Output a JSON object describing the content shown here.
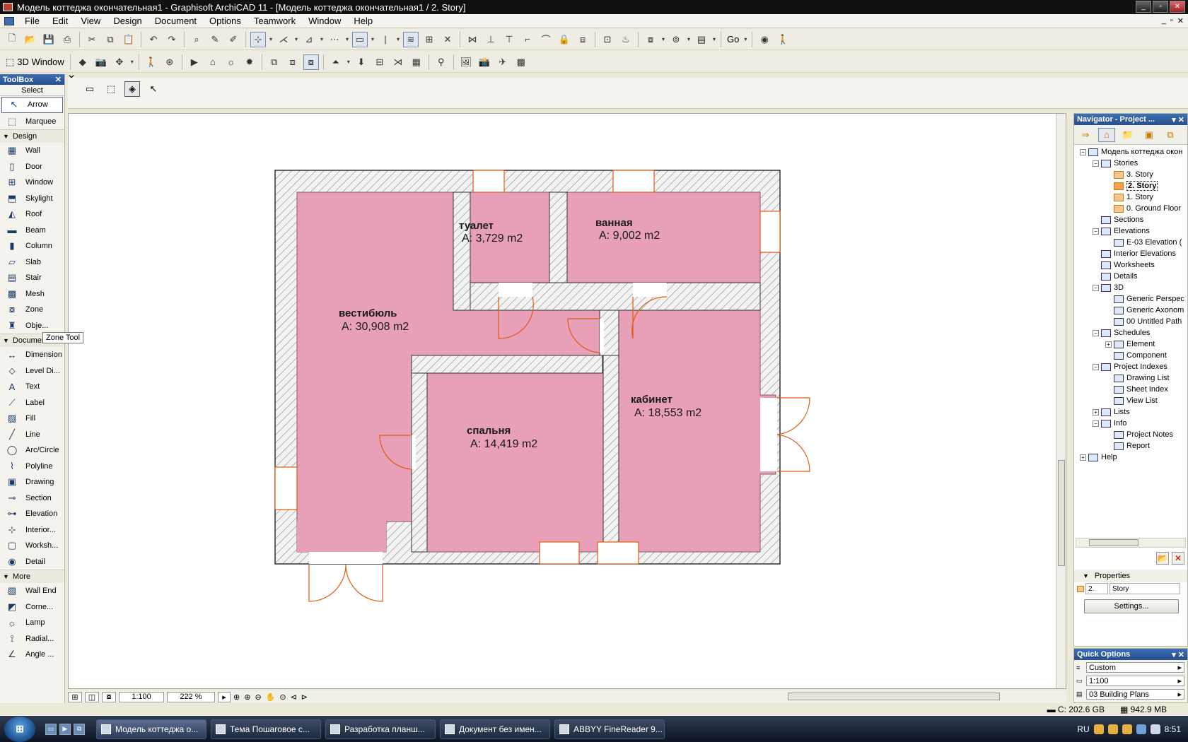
{
  "window": {
    "title": "Модель коттеджа окончательная1 - Graphisoft ArchiCAD 11 - [Модель коттеджа окончательная1 / 2. Story]"
  },
  "menu": [
    "File",
    "Edit",
    "View",
    "Design",
    "Document",
    "Options",
    "Teamwork",
    "Window",
    "Help"
  ],
  "toolbar2": {
    "window3d_label": "3D Window",
    "go_label": "Go"
  },
  "toolbox": {
    "title": "ToolBox",
    "select_label": "Select",
    "select_items": [
      {
        "label": "Arrow",
        "icon": "arrow-icon"
      },
      {
        "label": "Marquee",
        "icon": "marquee-icon"
      }
    ],
    "groups": [
      {
        "label": "Design",
        "items": [
          "Wall",
          "Door",
          "Window",
          "Skylight",
          "Roof",
          "Beam",
          "Column",
          "Slab",
          "Stair",
          "Mesh",
          "Zone",
          "Obje..."
        ]
      },
      {
        "label": "Document",
        "items": [
          "Dimension",
          "Level Di...",
          "Text",
          "Label",
          "Fill",
          "Line",
          "Arc/Circle",
          "Polyline",
          "Drawing",
          "Section",
          "Elevation",
          "Interior...",
          "Worksh...",
          "Detail"
        ]
      },
      {
        "label": "More",
        "items": [
          "Wall End",
          "Corne...",
          "Lamp",
          "Radial...",
          "Angle ..."
        ]
      }
    ],
    "tooltip": "Zone Tool"
  },
  "plan": {
    "rooms": [
      {
        "name": "туалет",
        "area": "A: 3,729 m2"
      },
      {
        "name": "ванная",
        "area": "A: 9,002 m2"
      },
      {
        "name": "вестибюль",
        "area": "A: 30,908 m2"
      },
      {
        "name": "кабинет",
        "area": "A: 18,553 m2"
      },
      {
        "name": "спальня",
        "area": "A: 14,419 m2"
      }
    ],
    "colors": {
      "zone": "#e7a0b8",
      "wall": "#eeeeee",
      "door": "#e05a10"
    }
  },
  "status": {
    "scale": "1:100",
    "zoom": "222 %"
  },
  "navigator": {
    "title": "Navigator - Project ...",
    "tree": [
      {
        "label": "Модель коттеджа окон",
        "level": 0,
        "tog": "-",
        "icon": "house-icon"
      },
      {
        "label": "Stories",
        "level": 1,
        "tog": "-",
        "icon": "stories-icon"
      },
      {
        "label": "3. Story",
        "level": 2,
        "tog": "",
        "icon": "story-icon"
      },
      {
        "label": "2. Story",
        "level": 2,
        "tog": "",
        "icon": "story-icon",
        "current": true
      },
      {
        "label": "1. Story",
        "level": 2,
        "tog": "",
        "icon": "story-icon"
      },
      {
        "label": "0. Ground Floor",
        "level": 2,
        "tog": "",
        "icon": "story-icon"
      },
      {
        "label": "Sections",
        "level": 1,
        "tog": "",
        "icon": "section-icon"
      },
      {
        "label": "Elevations",
        "level": 1,
        "tog": "-",
        "icon": "elevation-icon"
      },
      {
        "label": "E-03 Elevation (",
        "level": 2,
        "tog": "",
        "icon": "elevation-icon"
      },
      {
        "label": "Interior Elevations",
        "level": 1,
        "tog": "",
        "icon": "interior-icon"
      },
      {
        "label": "Worksheets",
        "level": 1,
        "tog": "",
        "icon": "worksheet-icon"
      },
      {
        "label": "Details",
        "level": 1,
        "tog": "",
        "icon": "detail-icon"
      },
      {
        "label": "3D",
        "level": 1,
        "tog": "-",
        "icon": "cube-icon"
      },
      {
        "label": "Generic Perspec",
        "level": 2,
        "tog": "",
        "icon": "camera-icon"
      },
      {
        "label": "Generic Axonom",
        "level": 2,
        "tog": "",
        "icon": "axon-icon"
      },
      {
        "label": "00 Untitled Path",
        "level": 2,
        "tog": "",
        "icon": "path-icon"
      },
      {
        "label": "Schedules",
        "level": 1,
        "tog": "-",
        "icon": "schedule-icon"
      },
      {
        "label": "Element",
        "level": 2,
        "tog": "+",
        "icon": "schedule-icon"
      },
      {
        "label": "Component",
        "level": 2,
        "tog": "",
        "icon": "schedule-icon"
      },
      {
        "label": "Project Indexes",
        "level": 1,
        "tog": "-",
        "icon": "index-icon"
      },
      {
        "label": "Drawing List",
        "level": 2,
        "tog": "",
        "icon": "list-icon"
      },
      {
        "label": "Sheet Index",
        "level": 2,
        "tog": "",
        "icon": "list-icon"
      },
      {
        "label": "View List",
        "level": 2,
        "tog": "",
        "icon": "list-icon"
      },
      {
        "label": "Lists",
        "level": 1,
        "tog": "+",
        "icon": "list-icon"
      },
      {
        "label": "Info",
        "level": 1,
        "tog": "-",
        "icon": "info-icon"
      },
      {
        "label": "Project Notes",
        "level": 2,
        "tog": "",
        "icon": "notes-icon"
      },
      {
        "label": "Report",
        "level": 2,
        "tog": "",
        "icon": "report-icon"
      },
      {
        "label": "Help",
        "level": 0,
        "tog": "+",
        "icon": "help-icon"
      }
    ],
    "properties": {
      "header": "Properties",
      "index": "2.",
      "name": "Story",
      "settings_label": "Settings..."
    }
  },
  "quick_options": {
    "title": "Quick Options",
    "values": [
      "Custom",
      "1:100",
      "03 Building Plans"
    ]
  },
  "bottom_status": {
    "disk": "C: 202.6 GB",
    "memory": "942.9 MB"
  },
  "taskbar": {
    "tasks": [
      "Модель коттеджа о...",
      "Тема Пошаговое с...",
      "Разработка планш...",
      "Документ без имен...",
      "ABBYY FineReader 9..."
    ],
    "lang": "RU",
    "time": "8:51"
  }
}
